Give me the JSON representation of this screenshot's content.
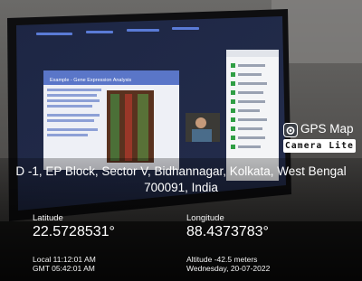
{
  "badge": {
    "title": "GPS Map",
    "subtitle": "Camera Lite",
    "icon": "camera-icon"
  },
  "address": {
    "line1": "D -1, EP Block, Sector V, Bidhannagar, Kolkata, West Bengal",
    "line2": "700091, India"
  },
  "latitude": {
    "label": "Latitude",
    "value": "22.5728531°"
  },
  "longitude": {
    "label": "Longitude",
    "value": "88.4373783°"
  },
  "time": {
    "local": "Local 11:12:01 AM",
    "gmt": "GMT 05:42:01 AM"
  },
  "altitude": {
    "text": "Altitude -42.5 meters",
    "date": "Wednesday, 20-07-2022"
  },
  "slide": {
    "title": "Example - Gene Expression Analysis"
  }
}
